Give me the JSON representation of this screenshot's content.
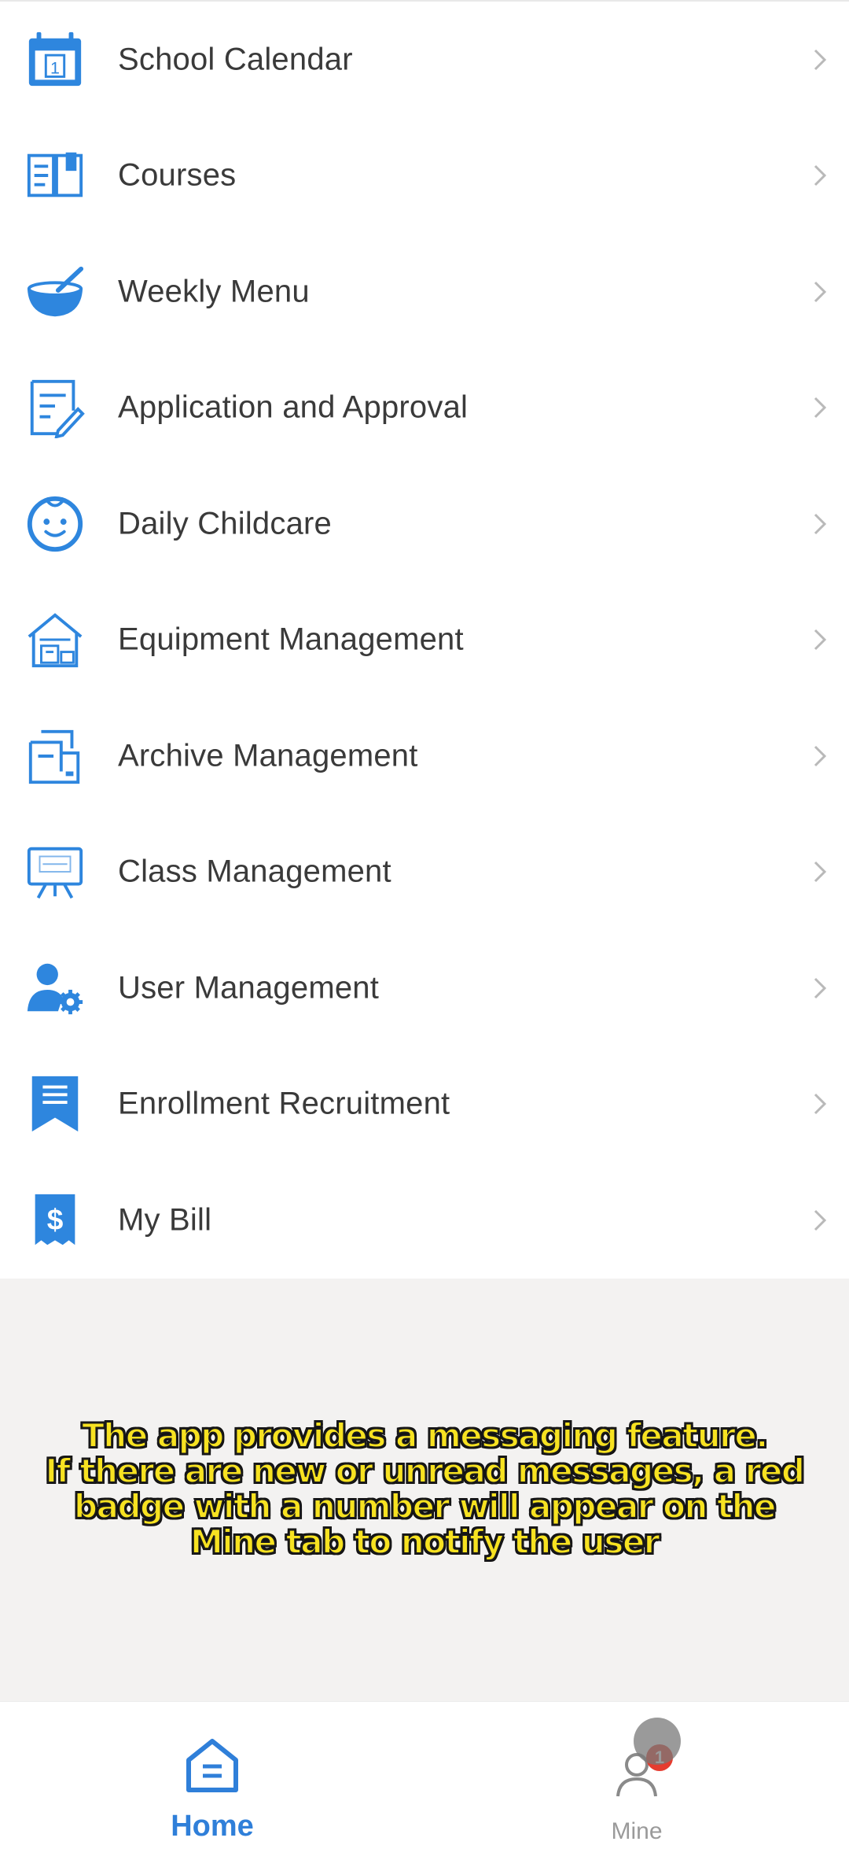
{
  "menu": {
    "items": [
      {
        "label": "School Calendar",
        "icon": "calendar-icon"
      },
      {
        "label": "Courses",
        "icon": "book-icon"
      },
      {
        "label": "Weekly Menu",
        "icon": "bowl-icon"
      },
      {
        "label": "Application and Approval",
        "icon": "form-edit-icon"
      },
      {
        "label": "Daily Childcare",
        "icon": "baby-face-icon"
      },
      {
        "label": "Equipment Management",
        "icon": "warehouse-icon"
      },
      {
        "label": "Archive Management",
        "icon": "archive-icon"
      },
      {
        "label": "Class Management",
        "icon": "presentation-board-icon"
      },
      {
        "label": "User Management",
        "icon": "user-settings-icon"
      },
      {
        "label": "Enrollment Recruitment",
        "icon": "bookmark-list-icon"
      },
      {
        "label": "My Bill",
        "icon": "dollar-bill-icon"
      }
    ],
    "calendar_day": "1"
  },
  "caption": {
    "lines": [
      "The app provides a messaging feature.",
      "If there are new or unread messages, a red",
      "badge with a number will appear on the",
      "Mine tab to notify the user"
    ]
  },
  "tabbar": {
    "home": {
      "label": "Home",
      "icon": "home-icon",
      "active": true
    },
    "mine": {
      "label": "Mine",
      "icon": "person-icon",
      "badge": "1"
    }
  },
  "colors": {
    "accent": "#2f7fd9",
    "icon_blue": "#2e86de",
    "badge_red": "#e53c2f",
    "caption_yellow": "#f7e221",
    "grey_background": "#f3f2f1"
  }
}
